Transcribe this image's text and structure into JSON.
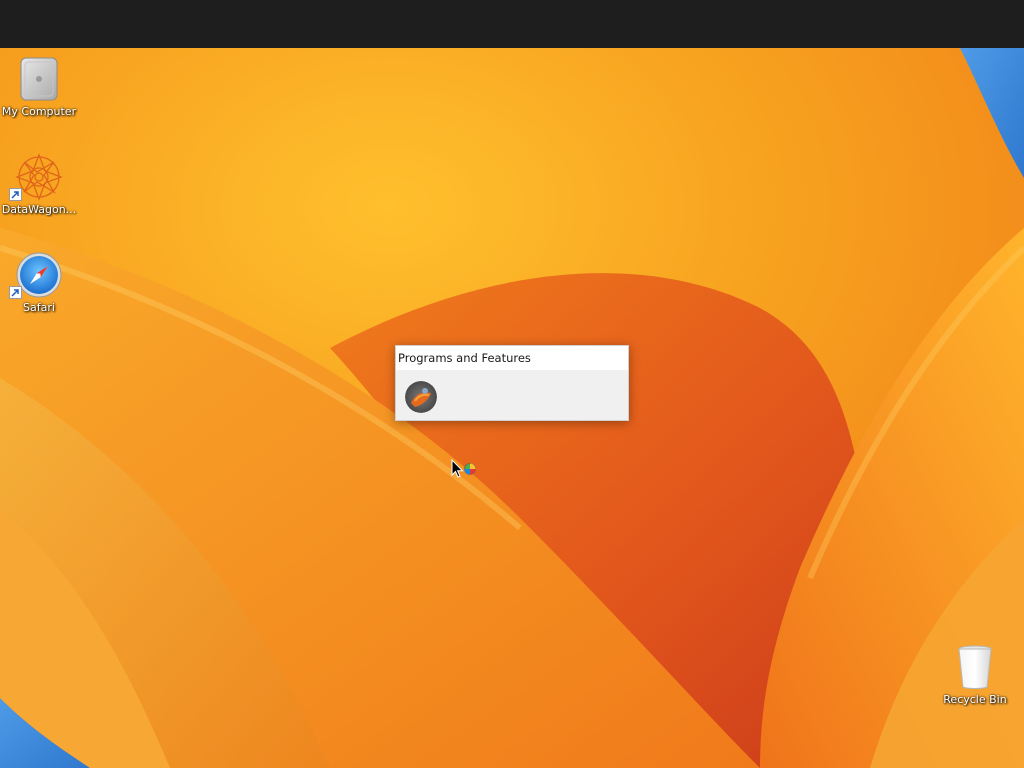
{
  "desktop": {
    "icons": [
      {
        "label": "My Computer",
        "icon": "computer-icon",
        "shortcut": false
      },
      {
        "label": "DataWagon...",
        "icon": "datawagon-icon",
        "shortcut": true
      },
      {
        "label": "Safari",
        "icon": "safari-compass-icon",
        "shortcut": true
      },
      {
        "label": "Recycle Bin",
        "icon": "recycle-bin-icon",
        "shortcut": false
      }
    ]
  },
  "taskbar_preview": {
    "title": "Programs and Features",
    "thumbnail_icon": "programs-features-thumbnail-icon"
  },
  "colors": {
    "top_bar": "#1e1e1e",
    "wallpaper_orange": "#f39a1e",
    "wallpaper_red": "#d8431c",
    "wallpaper_blue": "#3b8fe0"
  }
}
